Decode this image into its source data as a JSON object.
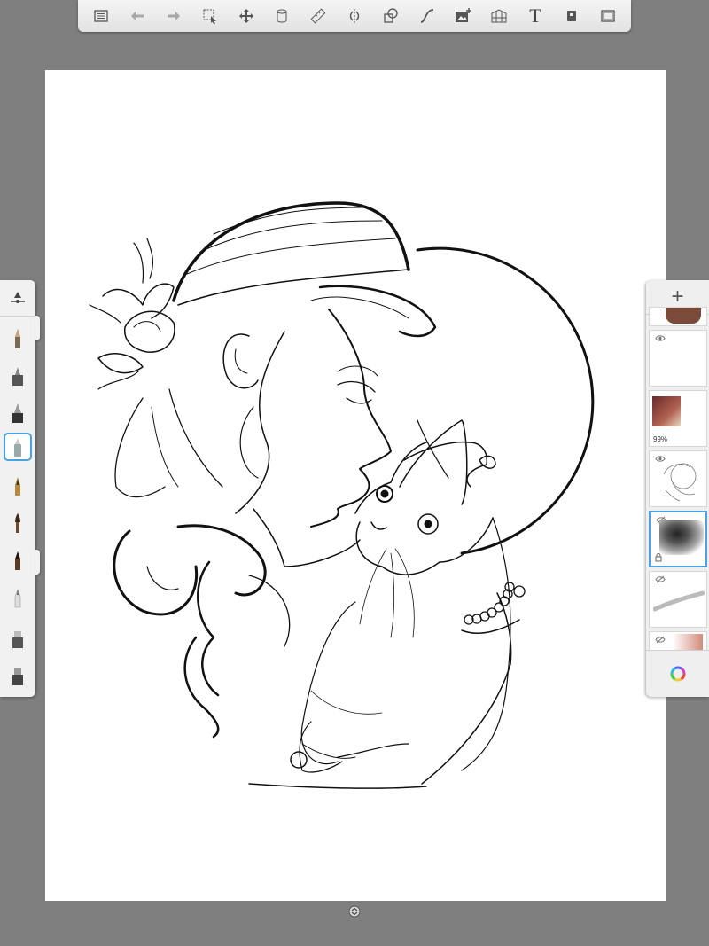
{
  "toolbar": {
    "buttons": [
      {
        "name": "list-icon",
        "enabled": true
      },
      {
        "name": "undo-icon",
        "enabled": false
      },
      {
        "name": "redo-icon",
        "enabled": false
      },
      {
        "name": "selection-icon",
        "enabled": true
      },
      {
        "name": "transform-icon",
        "enabled": true
      },
      {
        "name": "copic-icon",
        "enabled": true
      },
      {
        "name": "ruler-icon",
        "enabled": true
      },
      {
        "name": "symmetry-icon",
        "enabled": true
      },
      {
        "name": "shape-icon",
        "enabled": true
      },
      {
        "name": "stroke-icon",
        "enabled": true
      },
      {
        "name": "image-add-icon",
        "enabled": true
      },
      {
        "name": "perspective-icon",
        "enabled": true
      },
      {
        "name": "text-icon",
        "enabled": true
      },
      {
        "name": "layer-mode-icon",
        "enabled": true
      },
      {
        "name": "fullscreen-icon",
        "enabled": true
      }
    ],
    "text_tool_label": "T"
  },
  "brushes": {
    "items": [
      "pencil",
      "marker",
      "ink-pen",
      "airbrush",
      "fountain-pen",
      "paintbrush",
      "chisel-marker",
      "soft-pencil",
      "eraser",
      "hard-eraser"
    ],
    "selected_index": 3
  },
  "layers": {
    "add_label": "+",
    "items": [
      {
        "name": "layer-top-partial",
        "visible": true
      },
      {
        "name": "layer-blank",
        "visible": true
      },
      {
        "name": "layer-photo",
        "visible": true,
        "opacity_label": "99%"
      },
      {
        "name": "layer-lineart",
        "visible": true
      },
      {
        "name": "layer-shading",
        "visible": false,
        "selected": true
      },
      {
        "name": "layer-brush-stroke",
        "visible": false
      },
      {
        "name": "layer-bottom-partial",
        "visible": false
      }
    ]
  },
  "colors": {
    "accent": "#4aa3e0",
    "background": "#7f7f7f",
    "panel": "#efefef"
  }
}
